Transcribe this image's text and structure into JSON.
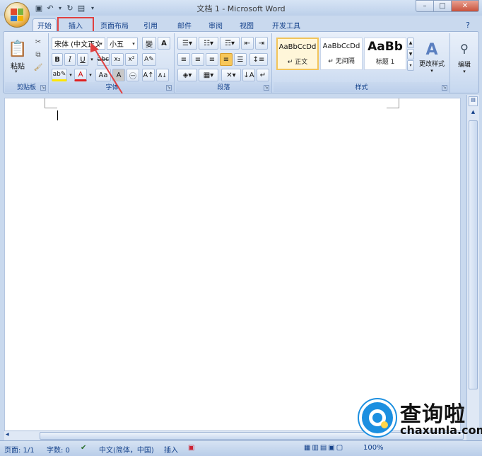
{
  "window": {
    "title": "文档 1 - Microsoft Word"
  },
  "tabs": [
    "开始",
    "插入",
    "页面布局",
    "引用",
    "邮件",
    "审阅",
    "视图",
    "开发工具"
  ],
  "clipboard": {
    "paste_label": "粘贴",
    "group_label": "剪贴板"
  },
  "font": {
    "name": "宋体 (中文正文)",
    "size": "小五",
    "group_label": "字体"
  },
  "paragraph": {
    "group_label": "段落"
  },
  "styles": {
    "items": [
      {
        "sample": "AaBbCcDd",
        "name": "↵ 正文"
      },
      {
        "sample": "AaBbCcDd",
        "name": "↵ 无间隔"
      },
      {
        "sample": "AaBb",
        "name": "标题 1"
      }
    ],
    "change_label": "更改样式",
    "group_label": "样式"
  },
  "editing": {
    "label": "编辑"
  },
  "status": {
    "page": "页面: 1/1",
    "words": "字数: 0",
    "language": "中文(简体，中国)",
    "mode": "插入",
    "zoom": "100%"
  },
  "watermark": {
    "cn": "查询啦",
    "en": "chaxunla.com"
  },
  "colors": {
    "highlight_box": "#e04040",
    "arrow": "#e04040",
    "accent": "#15428b"
  }
}
